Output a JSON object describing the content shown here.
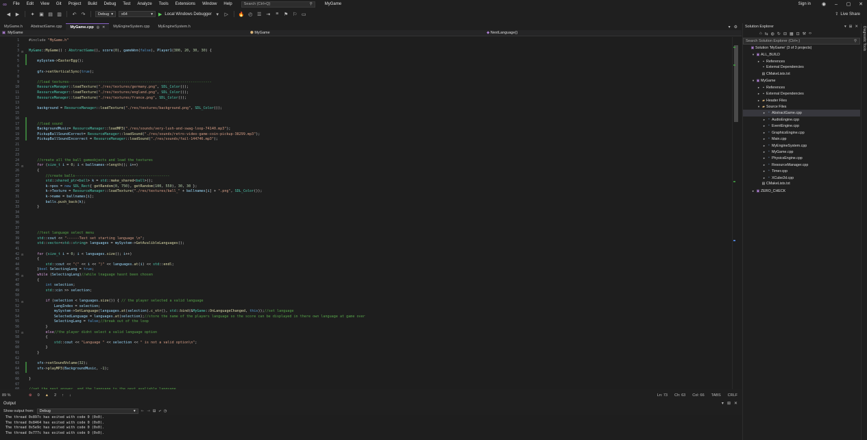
{
  "menubar": {
    "items": [
      "File",
      "Edit",
      "View",
      "Git",
      "Project",
      "Build",
      "Debug",
      "Test",
      "Analyze",
      "Tools",
      "Extensions",
      "Window",
      "Help"
    ],
    "search_placeholder": "Search (Ctrl+Q)",
    "solution_name": "MyGame",
    "sign_in": "Sign in"
  },
  "toolbar": {
    "config": "Debug",
    "platform": "x64",
    "run_label": "Local Windows Debugger",
    "live_share": "Live Share"
  },
  "tabs": [
    {
      "label": "MyGame.h",
      "active": false
    },
    {
      "label": "AbstractGame.cpp",
      "active": false
    },
    {
      "label": "MyGame.cpp",
      "active": true
    },
    {
      "label": "MyEngineSystem.cpp",
      "active": false
    },
    {
      "label": "MyEngineSystem.h",
      "active": false
    }
  ],
  "navbar": {
    "project": "MyGame",
    "scope": "MyGame",
    "member": "NextLanguage()"
  },
  "code_lines": [
    {
      "n": "1",
      "html": "<span class=\"pp\">#include</span> <span class=\"s\">\"MyGame.h\"</span>"
    },
    {
      "n": "2",
      "html": ""
    },
    {
      "n": "3",
      "html": "<span class=\"t\">MyGame</span><span class=\"p\">::</span><span class=\"f\">MyGame</span><span class=\"p\">() : </span><span class=\"t\">AbstractGame</span><span class=\"p\">(), </span><span class=\"m\">score</span><span class=\"p\">(</span><span class=\"n\">0</span><span class=\"p\">), </span><span class=\"m\">gameWon</span><span class=\"p\">(</span><span class=\"k\">false</span><span class=\"p\">), </span><span class=\"m\">Player1</span><span class=\"p\">(</span><span class=\"n\">300</span><span class=\"p\">, </span><span class=\"n\">20</span><span class=\"p\">, </span><span class=\"n\">30</span><span class=\"p\">, </span><span class=\"n\">30</span><span class=\"p\">) {</span>"
    },
    {
      "n": "4",
      "html": ""
    },
    {
      "n": "5",
      "html": "    <span class=\"m\">mySystem</span><span class=\"p\">-></span><span class=\"f\">EasterEgg</span><span class=\"p\">();</span>"
    },
    {
      "n": "6",
      "html": ""
    },
    {
      "n": "7",
      "html": "    <span class=\"m\">gfx</span><span class=\"p\">-></span><span class=\"f\">setVerticalSync</span><span class=\"p\">(</span><span class=\"k\">true</span><span class=\"p\">);</span>"
    },
    {
      "n": "8",
      "html": ""
    },
    {
      "n": "9",
      "html": "    <span class=\"c\">//load textures--------------------------------------------------------------------</span>"
    },
    {
      "n": "10",
      "html": "    <span class=\"t\">ResourceManager</span><span class=\"p\">::</span><span class=\"f\">loadTexture</span><span class=\"p\">(</span><span class=\"s\">\"./res/textures/germany.png\"</span><span class=\"p\">, </span><span class=\"t\">SDL_Color</span><span class=\"p\">());</span>"
    },
    {
      "n": "11",
      "html": "    <span class=\"t\">ResourceManager</span><span class=\"p\">::</span><span class=\"f\">loadTexture</span><span class=\"p\">(</span><span class=\"s\">\"./res/textures/england.png\"</span><span class=\"p\">, </span><span class=\"t\">SDL_Color</span><span class=\"p\">());</span>"
    },
    {
      "n": "12",
      "html": "    <span class=\"t\">ResourceManager</span><span class=\"p\">::</span><span class=\"f\">loadTexture</span><span class=\"p\">(</span><span class=\"s\">\"./res/textures/france.png\"</span><span class=\"p\">, </span><span class=\"t\">SDL_Color</span><span class=\"p\">());</span>"
    },
    {
      "n": "13",
      "html": ""
    },
    {
      "n": "14",
      "html": "    <span class=\"m\">background</span><span class=\"p\"> = </span><span class=\"t\">ResourceManager</span><span class=\"p\">::</span><span class=\"f\">loadTexture</span><span class=\"p\">(</span><span class=\"s\">\"./res/textures/background.png\"</span><span class=\"p\">, </span><span class=\"t\">SDL_Color</span><span class=\"p\">());</span>"
    },
    {
      "n": "15",
      "html": ""
    },
    {
      "n": "16",
      "html": ""
    },
    {
      "n": "17",
      "html": "    <span class=\"c\">//load sound</span>"
    },
    {
      "n": "18",
      "html": "    <span class=\"m\">BackgroundMusic</span><span class=\"p\">= </span><span class=\"t\">ResourceManager</span><span class=\"p\">::</span><span class=\"f\">loadMP3</span><span class=\"p\">(</span><span class=\"s\">\"./res/sounds/very-lush-and-swag-loop-74140.mp3\"</span><span class=\"p\">);</span>"
    },
    {
      "n": "19",
      "html": "    <span class=\"m\">PickupBallSoundCorrect</span><span class=\"p\">= </span><span class=\"t\">ResourceManager</span><span class=\"p\">::</span><span class=\"f\">loadSound</span><span class=\"p\">(</span><span class=\"s\">\"./res/sounds/retro-video-game-coin-pickup-38299.mp3\"</span><span class=\"p\">);</span>"
    },
    {
      "n": "20",
      "html": "    <span class=\"m\">PickupBallSoundIncorrect</span><span class=\"p\"> = </span><span class=\"t\">ResourceManager</span><span class=\"p\">::</span><span class=\"f\">loadSound</span><span class=\"p\">(</span><span class=\"s\">\"./res/sounds/fail-144746.mp3\"</span><span class=\"p\">);</span>"
    },
    {
      "n": "21",
      "html": ""
    },
    {
      "n": "22",
      "html": ""
    },
    {
      "n": "23",
      "html": ""
    },
    {
      "n": "24",
      "html": "    <span class=\"c\">//create all the ball gameobjects and load the textures</span>"
    },
    {
      "n": "25",
      "html": "    <span class=\"ctrl\">for</span><span class=\"p\"> (</span><span class=\"t\">size_t</span><span class=\"p\"> </span><span class=\"m\">i</span><span class=\"p\"> = </span><span class=\"n\">0</span><span class=\"p\">; </span><span class=\"m\">i</span><span class=\"p\"> &lt; </span><span class=\"m\">ballnames</span><span class=\"p\">-></span><span class=\"f\">length</span><span class=\"p\">(); </span><span class=\"m\">i</span><span class=\"p\">++)</span>"
    },
    {
      "n": "26",
      "html": "    <span class=\"p\">{</span>"
    },
    {
      "n": "27",
      "html": "        <span class=\"c\">//create balls---------------------------------------------</span>"
    },
    {
      "n": "28",
      "html": "        <span class=\"t\">std</span><span class=\"p\">::</span><span class=\"t\">shared_ptr</span><span class=\"p\">&lt;</span><span class=\"t\">ball</span><span class=\"p\">&gt; </span><span class=\"m\">k</span><span class=\"p\"> = </span><span class=\"t\">std</span><span class=\"p\">::</span><span class=\"f\">make_shared</span><span class=\"p\">&lt;</span><span class=\"t\">ball</span><span class=\"p\">&gt;();</span>"
    },
    {
      "n": "29",
      "html": "        <span class=\"m\">k</span><span class=\"p\">-></span><span class=\"m\">pos</span><span class=\"p\"> = </span><span class=\"k\">new</span><span class=\"p\"> </span><span class=\"t\">SDL_Rect</span><span class=\"p\">{ </span><span class=\"f\">getRandom</span><span class=\"p\">(</span><span class=\"n\">0</span><span class=\"p\">, </span><span class=\"n\">750</span><span class=\"p\">), </span><span class=\"f\">getRandom</span><span class=\"p\">(</span><span class=\"n\">100</span><span class=\"p\">, </span><span class=\"n\">550</span><span class=\"p\">), </span><span class=\"n\">30</span><span class=\"p\">, </span><span class=\"n\">30</span><span class=\"p\"> };</span>"
    },
    {
      "n": "30",
      "html": "        <span class=\"m\">k</span><span class=\"p\">-></span><span class=\"m\">Texture</span><span class=\"p\"> = </span><span class=\"t\">ResourceManager</span><span class=\"p\">::</span><span class=\"f\">loadTexture</span><span class=\"p\">(</span><span class=\"s\">\"./res/textures/ball_\"</span><span class=\"p\"> + </span><span class=\"m\">ballnames</span><span class=\"p\">[</span><span class=\"m\">i</span><span class=\"p\">] + </span><span class=\"s\">\".png\"</span><span class=\"p\">, </span><span class=\"t\">SDL_Color</span><span class=\"p\">());</span>"
    },
    {
      "n": "31",
      "html": "        <span class=\"m\">k</span><span class=\"p\">-></span><span class=\"m\">name</span><span class=\"p\"> = </span><span class=\"m\">ballnames</span><span class=\"p\">[</span><span class=\"m\">i</span><span class=\"p\">];</span>"
    },
    {
      "n": "32",
      "html": "        <span class=\"m\">balls</span><span class=\"p\">.</span><span class=\"f\">push_back</span><span class=\"p\">(</span><span class=\"m\">k</span><span class=\"p\">);</span>"
    },
    {
      "n": "33",
      "html": "    <span class=\"p\">}</span>"
    },
    {
      "n": "34",
      "html": ""
    },
    {
      "n": "35",
      "html": ""
    },
    {
      "n": "36",
      "html": ""
    },
    {
      "n": "37",
      "html": ""
    },
    {
      "n": "38",
      "html": "    <span class=\"c\">//test language select menu</span>"
    },
    {
      "n": "39",
      "html": "    <span class=\"t\">std</span><span class=\"p\">::</span><span class=\"m\">cout</span><span class=\"p\"> &lt;&lt; </span><span class=\"s\">\"------Test set starting language \\n\"</span><span class=\"p\">;</span>"
    },
    {
      "n": "40",
      "html": "    <span class=\"t\">std</span><span class=\"p\">::</span><span class=\"t\">vector</span><span class=\"p\">&lt;</span><span class=\"t\">std</span><span class=\"p\">::</span><span class=\"t\">string</span><span class=\"p\">&gt; </span><span class=\"m\">languages</span><span class=\"p\"> = </span><span class=\"m\">mySystem</span><span class=\"p\">-></span><span class=\"f\">GetAvalibleLanguages</span><span class=\"p\">();</span>"
    },
    {
      "n": "41",
      "html": ""
    },
    {
      "n": "42",
      "html": "    <span class=\"ctrl\">for</span><span class=\"p\"> (</span><span class=\"t\">size_t</span><span class=\"p\"> </span><span class=\"m\">i</span><span class=\"p\"> = </span><span class=\"n\">0</span><span class=\"p\">; </span><span class=\"m\">i</span><span class=\"p\"> &lt; </span><span class=\"m\">languages</span><span class=\"p\">.</span><span class=\"f\">size</span><span class=\"p\">(); </span><span class=\"m\">i</span><span class=\"p\">++)</span>"
    },
    {
      "n": "43",
      "html": "    <span class=\"p\">{</span>"
    },
    {
      "n": "44",
      "html": "        <span class=\"t\">std</span><span class=\"p\">::</span><span class=\"m\">cout</span><span class=\"p\"> &lt;&lt; </span><span class=\"s\">\"(\"</span><span class=\"p\"> &lt;&lt; </span><span class=\"m\">i</span><span class=\"p\"> &lt;&lt; </span><span class=\"s\">\")\"</span><span class=\"p\"> &lt;&lt; </span><span class=\"m\">languages</span><span class=\"p\">.</span><span class=\"f\">at</span><span class=\"p\">(</span><span class=\"m\">i</span><span class=\"p\">) &lt;&lt; </span><span class=\"t\">std</span><span class=\"p\">::</span><span class=\"f\">endl</span><span class=\"p\">;</span>"
    },
    {
      "n": "45",
      "html": "    <span class=\"p\">}</span><span class=\"k\">bool</span><span class=\"p\"> </span><span class=\"m\">SelectingLang</span><span class=\"p\"> = </span><span class=\"k\">true</span><span class=\"p\">;</span>"
    },
    {
      "n": "46",
      "html": "    <span class=\"ctrl\">while</span><span class=\"p\"> (</span><span class=\"m\">SelectingLang</span><span class=\"p\">)</span><span class=\"c\">//while lnaguage hasnt been chosen</span>"
    },
    {
      "n": "47",
      "html": "    <span class=\"p\">{</span>"
    },
    {
      "n": "48",
      "html": "        <span class=\"k\">int</span><span class=\"p\"> </span><span class=\"m\">selection</span><span class=\"p\">;</span>"
    },
    {
      "n": "49",
      "html": "        <span class=\"t\">std</span><span class=\"p\">::</span><span class=\"m\">cin</span><span class=\"p\"> &gt;&gt; </span><span class=\"m\">selection</span><span class=\"p\">;</span>"
    },
    {
      "n": "50",
      "html": ""
    },
    {
      "n": "51",
      "html": "        <span class=\"ctrl\">if</span><span class=\"p\"> (</span><span class=\"m\">selection</span><span class=\"p\"> &lt; </span><span class=\"m\">languages</span><span class=\"p\">.</span><span class=\"f\">size</span><span class=\"p\">()) { </span><span class=\"c\">// the player selected a valid language</span>"
    },
    {
      "n": "52",
      "html": "            <span class=\"m\">LangIndex</span><span class=\"p\"> = </span><span class=\"m\">selection</span><span class=\"p\">;</span>"
    },
    {
      "n": "53",
      "html": "            <span class=\"m\">mySystem</span><span class=\"p\">-></span><span class=\"f\">SetLanguage</span><span class=\"p\">(</span><span class=\"m\">languages</span><span class=\"p\">.</span><span class=\"f\">at</span><span class=\"p\">(</span><span class=\"m\">selection</span><span class=\"p\">).</span><span class=\"f\">c_str</span><span class=\"p\">(), </span><span class=\"t\">std</span><span class=\"p\">::</span><span class=\"f\">bind</span><span class=\"p\">(&amp;</span><span class=\"t\">MyGame</span><span class=\"p\">::</span><span class=\"f\">OnLanguageChanged</span><span class=\"p\">, </span><span class=\"k\">this</span><span class=\"p\">));</span><span class=\"c\">//set language</span>"
    },
    {
      "n": "54",
      "html": "            <span class=\"m\">SelectedLanguage</span><span class=\"p\"> = </span><span class=\"m\">languages</span><span class=\"p\">.</span><span class=\"f\">at</span><span class=\"p\">(</span><span class=\"m\">selection</span><span class=\"p\">);</span><span class=\"c\">//store the name of the players language so the score can be displayed in there own language at game over</span>"
    },
    {
      "n": "55",
      "html": "            <span class=\"m\">SelectingLang</span><span class=\"p\"> = </span><span class=\"k\">false</span><span class=\"p\">;</span><span class=\"c\">//break out of the loop</span>"
    },
    {
      "n": "56",
      "html": "        <span class=\"p\">}</span>"
    },
    {
      "n": "57",
      "html": "        <span class=\"ctrl\">else</span><span class=\"c\">//the player didnt select a valid language option</span>"
    },
    {
      "n": "58",
      "html": "        <span class=\"p\">{</span>"
    },
    {
      "n": "59",
      "html": "            <span class=\"t\">std</span><span class=\"p\">::</span><span class=\"m\">cout</span><span class=\"p\"> &lt;&lt; </span><span class=\"s\">\"Language \"</span><span class=\"p\"> &lt;&lt; </span><span class=\"m\">selection</span><span class=\"p\"> &lt;&lt; </span><span class=\"s\">\" is not a valid option\\n\"</span><span class=\"p\">;</span>"
    },
    {
      "n": "60",
      "html": "        <span class=\"p\">}</span>"
    },
    {
      "n": "61",
      "html": "    <span class=\"p\">}</span>"
    },
    {
      "n": "62",
      "html": ""
    },
    {
      "n": "63",
      "html": "    <span class=\"m\">sfx</span><span class=\"p\">-></span><span class=\"f\">setSoundVolume</span><span class=\"p\">(</span><span class=\"n\">32</span><span class=\"p\">);</span>"
    },
    {
      "n": "64",
      "html": "    <span class=\"m\">sfx</span><span class=\"p\">-></span><span class=\"f\">playMP3</span><span class=\"p\">(</span><span class=\"m\">BackgroundMusic</span><span class=\"p\">, -</span><span class=\"n\">1</span><span class=\"p\">);</span>"
    },
    {
      "n": "65",
      "html": ""
    },
    {
      "n": "66",
      "html": "<span class=\"p\">}</span>"
    },
    {
      "n": "67",
      "html": ""
    },
    {
      "n": "68",
      "html": "<span class=\"c\">//set the next answer, and the language to the next avaliable language</span>"
    }
  ],
  "status": {
    "zoom": "89 %",
    "errors": "0",
    "warnings": "2",
    "line": "Ln: 73",
    "ch": "Ch: 63",
    "col": "Col: 66",
    "tabs": "TABS",
    "eol": "CRLF"
  },
  "output": {
    "title": "Output",
    "show_from_label": "Show output from:",
    "source": "Debug",
    "lines": [
      "The thread 0x897c has exited with code 0 (0x0).",
      "The thread 0x8464 has exited with code 0 (0x0).",
      "The thread 0x5e9c has exited with code 0 (0x0).",
      "The thread 0x777c has exited with code 0 (0x0)."
    ]
  },
  "solution_explorer": {
    "title": "Solution Explorer",
    "search_placeholder": "Search Solution Explorer (Ctrl+;)",
    "items": [
      {
        "label": "Solution 'MyGame' (3 of 3 projects)",
        "indent": 0,
        "arrow": "",
        "icon": "sol",
        "selected": false
      },
      {
        "label": "ALL_BUILD",
        "indent": 1,
        "arrow": "▾",
        "icon": "proj",
        "selected": false
      },
      {
        "label": "References",
        "indent": 2,
        "arrow": "▸",
        "icon": "ref",
        "selected": false
      },
      {
        "label": "External Dependencies",
        "indent": 2,
        "arrow": "",
        "icon": "ref",
        "selected": false
      },
      {
        "label": "CMakeLists.txt",
        "indent": 2,
        "arrow": "",
        "icon": "file",
        "selected": false
      },
      {
        "label": "MyGame",
        "indent": 1,
        "arrow": "▾",
        "icon": "proj",
        "selected": false
      },
      {
        "label": "References",
        "indent": 2,
        "arrow": "▸",
        "icon": "ref",
        "selected": false
      },
      {
        "label": "External Dependencies",
        "indent": 2,
        "arrow": "▸",
        "icon": "ref",
        "selected": false
      },
      {
        "label": "Header Files",
        "indent": 2,
        "arrow": "▸",
        "icon": "folder",
        "selected": false
      },
      {
        "label": "Source Files",
        "indent": 2,
        "arrow": "▾",
        "icon": "folder",
        "selected": false
      },
      {
        "label": "AbstractGame.cpp",
        "indent": 3,
        "arrow": "▸",
        "icon": "cpp",
        "selected": true
      },
      {
        "label": "AudioEngine.cpp",
        "indent": 3,
        "arrow": "▸",
        "icon": "cpp",
        "selected": false
      },
      {
        "label": "EventEngine.cpp",
        "indent": 3,
        "arrow": "▸",
        "icon": "cpp",
        "selected": false
      },
      {
        "label": "GraphicsEngine.cpp",
        "indent": 3,
        "arrow": "▸",
        "icon": "cpp",
        "selected": false
      },
      {
        "label": "Main.cpp",
        "indent": 3,
        "arrow": "▸",
        "icon": "cpp",
        "selected": false
      },
      {
        "label": "MyEngineSystem.cpp",
        "indent": 3,
        "arrow": "▸",
        "icon": "cpp",
        "selected": false
      },
      {
        "label": "MyGame.cpp",
        "indent": 3,
        "arrow": "▸",
        "icon": "cpp",
        "selected": false
      },
      {
        "label": "PhysicsEngine.cpp",
        "indent": 3,
        "arrow": "▸",
        "icon": "cpp",
        "selected": false
      },
      {
        "label": "ResourceManager.cpp",
        "indent": 3,
        "arrow": "▸",
        "icon": "cpp",
        "selected": false
      },
      {
        "label": "Timer.cpp",
        "indent": 3,
        "arrow": "▸",
        "icon": "cpp",
        "selected": false
      },
      {
        "label": "XCube2d.cpp",
        "indent": 3,
        "arrow": "▸",
        "icon": "cpp",
        "selected": false
      },
      {
        "label": "CMakeLists.txt",
        "indent": 2,
        "arrow": "",
        "icon": "file",
        "selected": false
      },
      {
        "label": "ZERO_CHECK",
        "indent": 1,
        "arrow": "▸",
        "icon": "proj",
        "selected": false
      }
    ]
  },
  "side_strip": {
    "label": "Diagnostic Tools"
  },
  "colors": {
    "accent": "#8a63c9",
    "editor_bg": "#1e1e1e",
    "chrome_bg": "#1f1f1f"
  }
}
